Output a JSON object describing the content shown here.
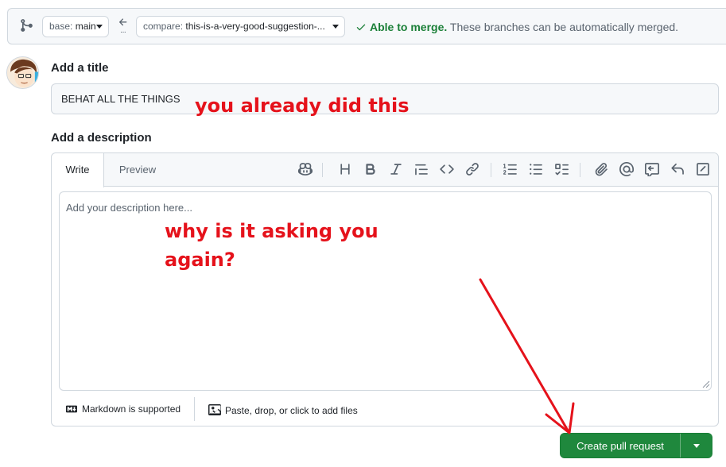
{
  "compare_bar": {
    "base_prefix": "base:",
    "base_branch": "main",
    "compare_prefix": "compare:",
    "compare_branch": "this-is-a-very-good-suggestion-...",
    "merge_ok": "Able to merge.",
    "merge_message": "These branches can be automatically merged."
  },
  "form": {
    "title_label": "Add a title",
    "title_value": "BEHAT ALL THE THINGS",
    "description_label": "Add a description",
    "description_placeholder": "Add your description here..."
  },
  "editor": {
    "tabs": [
      "Write",
      "Preview"
    ],
    "active_tab": "Write",
    "toolbar_icons": [
      "copilot-icon",
      "heading-icon",
      "bold-icon",
      "italic-icon",
      "quote-icon",
      "code-icon",
      "link-icon",
      "ordered-list-icon",
      "unordered-list-icon",
      "task-list-icon",
      "attach-icon",
      "mention-icon",
      "reference-icon",
      "undo-icon",
      "fullscreen-icon"
    ],
    "markdown_note": "Markdown is supported",
    "attach_note": "Paste, drop, or click to add files"
  },
  "actions": {
    "create_label": "Create pull request"
  },
  "annotations": {
    "title_comment": "you already did this",
    "desc_comment_line1": "why is it asking you",
    "desc_comment_line2": "again?",
    "color": "#e5121b"
  },
  "colors": {
    "success": "#1a7f37",
    "button": "#1f883d"
  }
}
